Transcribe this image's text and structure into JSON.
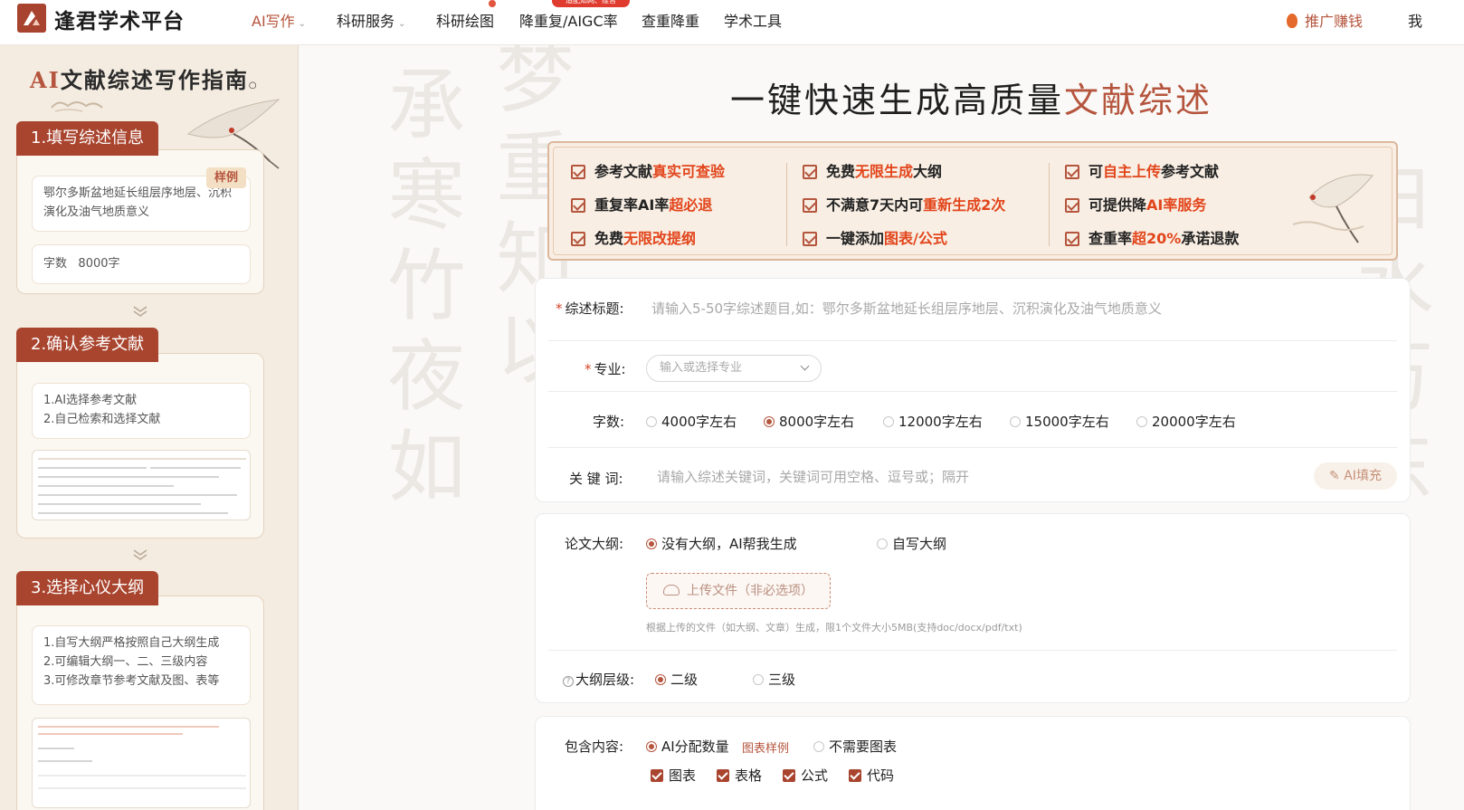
{
  "nav": {
    "brand": "逢君学术平台",
    "items": [
      {
        "label": "AI写作",
        "has_caret": true,
        "active": true
      },
      {
        "label": "科研服务",
        "has_caret": true,
        "active": false
      },
      {
        "label": "科研绘图",
        "has_caret": false,
        "active": false
      },
      {
        "label": "降重复/AIGC率",
        "has_caret": false,
        "active": false
      },
      {
        "label": "查重降重",
        "has_caret": false,
        "active": false
      },
      {
        "label": "学术工具",
        "has_caret": false,
        "active": false
      }
    ],
    "badge": "适配知网、维普",
    "promo": "推广赚钱",
    "me": "我"
  },
  "sidebar": {
    "title_ai": "AI",
    "title_rest": "文献综述写作指南",
    "steps": [
      {
        "tag": "1.填写综述信息",
        "sample_label": "样例",
        "sample_title": "鄂尔多斯盆地延长组层序地层、沉积演化及油气地质意义",
        "word_label": "字数",
        "word_value": "8000字"
      },
      {
        "tag": "2.确认参考文献",
        "lines": [
          "1.AI选择参考文献",
          "2.自己检索和选择文献"
        ]
      },
      {
        "tag": "3.选择心仪大纲",
        "lines": [
          "1.自写大纲严格按照自己大纲生成",
          "2.可编辑大纲一、二、三级内容",
          "3.可修改章节参考文献及图、表等"
        ]
      }
    ]
  },
  "main": {
    "headline_plain": "一键快速生成高质量",
    "headline_accent": "文献综述",
    "features": [
      {
        "pre": "参考文献",
        "hl": "真实可查验",
        "post": ""
      },
      {
        "pre": "免费",
        "hl": "无限生成",
        "post": "大纲"
      },
      {
        "pre": "可",
        "hl": "自主上传",
        "post": "参考文献"
      },
      {
        "pre": "重复率AI率",
        "hl": "超必退",
        "post": ""
      },
      {
        "pre": "不满意7天内可",
        "hl": "重新生成2次",
        "post": ""
      },
      {
        "pre": "可提供降",
        "hl": "AI率服务",
        "post": ""
      },
      {
        "pre": "免费",
        "hl": "无限改提纲",
        "post": ""
      },
      {
        "pre": "一键添加",
        "hl": "图表/公式",
        "post": ""
      },
      {
        "pre": "查重率",
        "hl": "超20%",
        "post": "承诺退款"
      }
    ],
    "form1": {
      "title_label": "综述标题:",
      "title_placeholder": "请输入5-50字综述题目,如：鄂尔多斯盆地延长组层序地层、沉积演化及油气地质意义",
      "major_label": "专业:",
      "major_placeholder": "输入或选择专业",
      "words_label": "字数:",
      "word_options": [
        {
          "label": "4000字左右",
          "selected": false
        },
        {
          "label": "8000字左右",
          "selected": true
        },
        {
          "label": "12000字左右",
          "selected": false
        },
        {
          "label": "15000字左右",
          "selected": false
        },
        {
          "label": "20000字左右",
          "selected": false
        }
      ],
      "keywords_label": "关 键 词:",
      "keywords_placeholder": "请输入综述关键词，关键词可用空格、逗号或；隔开",
      "ai_fill": "AI填充"
    },
    "form2": {
      "outline_label": "论文大纲:",
      "outline_options": [
        {
          "label": "没有大纲，AI帮我生成",
          "selected": true
        },
        {
          "label": "自写大纲",
          "selected": false
        }
      ],
      "upload_label": "上传文件（非必选项）",
      "upload_hint": "根据上传的文件（如大纲、文章）生成，限1个文件大小5MB(支持doc/docx/pdf/txt)",
      "level_label": "大纲层级:",
      "level_options": [
        {
          "label": "二级",
          "selected": true
        },
        {
          "label": "三级",
          "selected": false
        }
      ]
    },
    "form3": {
      "content_label": "包含内容:",
      "content_options": [
        {
          "label": "AI分配数量",
          "selected": true
        },
        {
          "label": "不需要图表",
          "selected": false
        }
      ],
      "sample_link": "图表样例",
      "checks": [
        "图表",
        "表格",
        "公式",
        "代码"
      ]
    }
  },
  "colors": {
    "accent": "#b5553d",
    "highlight": "#e2451b",
    "brand_dark": "#a9452f"
  }
}
